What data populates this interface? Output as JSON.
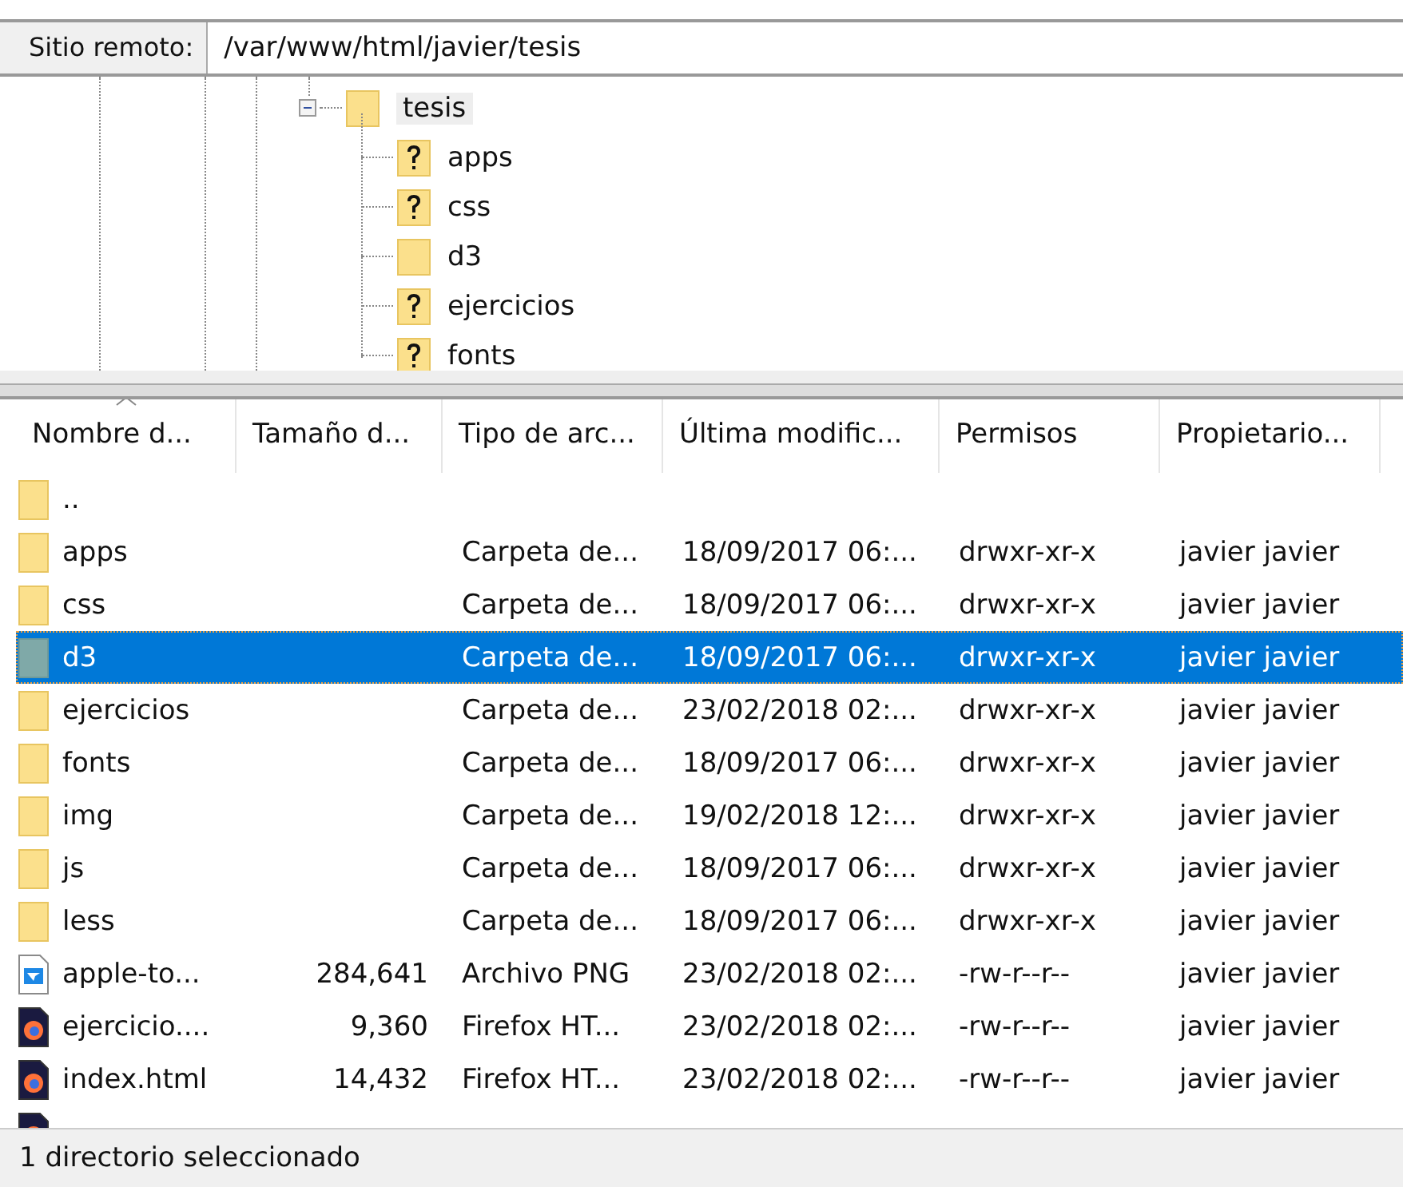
{
  "remote_site": {
    "label": "Sitio remoto:",
    "path": "/var/www/html/javier/tesis"
  },
  "tree": {
    "name": "tesis",
    "expanded": true,
    "selected": true,
    "children": [
      {
        "name": "apps",
        "unknown": true,
        "selected": false
      },
      {
        "name": "css",
        "unknown": true,
        "selected": false
      },
      {
        "name": "d3",
        "unknown": false,
        "selected": false
      },
      {
        "name": "ejercicios",
        "unknown": true,
        "selected": false
      },
      {
        "name": "fonts",
        "unknown": true,
        "selected": false
      }
    ]
  },
  "table": {
    "columns": [
      "Nombre d...",
      "Tamaño d...",
      "Tipo de arc...",
      "Última modific...",
      "Permisos",
      "Propietario..."
    ],
    "rows": [
      {
        "kind": "folder",
        "selected": false,
        "cells": [
          "..",
          "",
          "",
          "",
          "",
          ""
        ]
      },
      {
        "kind": "folder",
        "selected": false,
        "cells": [
          "apps",
          "",
          "Carpeta de...",
          "18/09/2017 06:...",
          "drwxr-xr-x",
          "javier javier"
        ]
      },
      {
        "kind": "folder",
        "selected": false,
        "cells": [
          "css",
          "",
          "Carpeta de...",
          "18/09/2017 06:...",
          "drwxr-xr-x",
          "javier javier"
        ]
      },
      {
        "kind": "folder",
        "selected": true,
        "cells": [
          "d3",
          "",
          "Carpeta de...",
          "18/09/2017 06:...",
          "drwxr-xr-x",
          "javier javier"
        ]
      },
      {
        "kind": "folder",
        "selected": false,
        "cells": [
          "ejercicios",
          "",
          "Carpeta de...",
          "23/02/2018 02:...",
          "drwxr-xr-x",
          "javier javier"
        ]
      },
      {
        "kind": "folder",
        "selected": false,
        "cells": [
          "fonts",
          "",
          "Carpeta de...",
          "18/09/2017 06:...",
          "drwxr-xr-x",
          "javier javier"
        ]
      },
      {
        "kind": "folder",
        "selected": false,
        "cells": [
          "img",
          "",
          "Carpeta de...",
          "19/02/2018 12:...",
          "drwxr-xr-x",
          "javier javier"
        ]
      },
      {
        "kind": "folder",
        "selected": false,
        "cells": [
          "js",
          "",
          "Carpeta de...",
          "18/09/2017 06:...",
          "drwxr-xr-x",
          "javier javier"
        ]
      },
      {
        "kind": "folder",
        "selected": false,
        "cells": [
          "less",
          "",
          "Carpeta de...",
          "18/09/2017 06:...",
          "drwxr-xr-x",
          "javier javier"
        ]
      },
      {
        "kind": "image",
        "selected": false,
        "cells": [
          "apple-to...",
          "284,641",
          "Archivo PNG",
          "23/02/2018 02:...",
          "-rw-r--r--",
          "javier javier"
        ]
      },
      {
        "kind": "firefox",
        "selected": false,
        "cells": [
          "ejercicio....",
          "9,360",
          "Firefox HT...",
          "23/02/2018 02:...",
          "-rw-r--r--",
          "javier javier"
        ]
      },
      {
        "kind": "firefox",
        "selected": false,
        "cells": [
          "index.html",
          "14,432",
          "Firefox HT...",
          "23/02/2018 02:...",
          "-rw-r--r--",
          "javier javier"
        ]
      }
    ]
  },
  "status_bar": "1 directorio seleccionado"
}
